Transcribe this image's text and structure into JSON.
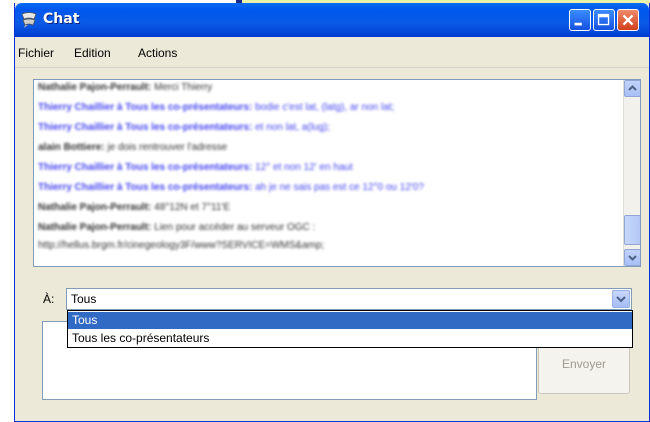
{
  "window": {
    "title": "Chat"
  },
  "menu": {
    "items": [
      "Fichier",
      "Edition",
      "Actions"
    ]
  },
  "log": {
    "lines": [
      {
        "who": "Nathalie Pajon-Perrault:",
        "text": " Merci Thierry",
        "style": "dark"
      },
      {
        "who": "Thierry Chaillier à Tous les co-présentateurs:",
        "text": " bodie c'est lat, (latg), ar non lat;",
        "style": "blue"
      },
      {
        "who": "Thierry Chaillier à Tous les co-présentateurs:",
        "text": " et non lat, a(lug);",
        "style": "blue"
      },
      {
        "who": "alain Bottiere:",
        "text": " je dois rentrouver l'adresse",
        "style": "dark"
      },
      {
        "who": "Thierry Chaillier à Tous les co-présentateurs:",
        "text": " 12° et non 12' en haut",
        "style": "blue"
      },
      {
        "who": "Thierry Chaillier à Tous les co-présentateurs:",
        "text": " ah je ne sais pas est ce 12°0 ou 12'0?",
        "style": "blue"
      },
      {
        "who": "Nathalie Pajon-Perrault:",
        "text": " 48°12N et 7°11'E",
        "style": "dark"
      },
      {
        "who": "Nathalie Pajon-Perrault:",
        "text": " Lien pour accéder au serveur OGC :",
        "style": "dark"
      },
      {
        "who": "",
        "text": "http://hellus.brgm.fr/cinegeology3F/www?SERVICE=WMS&amp;",
        "style": "dark"
      }
    ]
  },
  "recipient": {
    "label": "À:",
    "value": "Tous",
    "options": [
      "Tous",
      "Tous les co-présentateurs"
    ]
  },
  "send_button": {
    "label": "Envoyer"
  },
  "icons": {
    "window": "chat-app-icon",
    "minimize": "minimize-icon",
    "maximize": "maximize-icon",
    "close": "close-icon"
  },
  "colors": {
    "titlebar": "#0058ee",
    "selection": "#316ac5",
    "close": "#d1401a"
  }
}
